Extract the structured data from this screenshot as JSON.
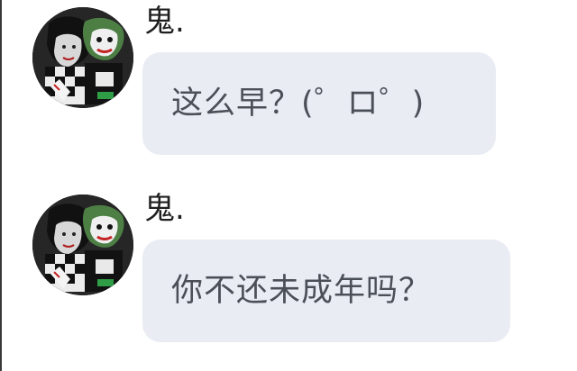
{
  "messages": [
    {
      "sender": "鬼.",
      "text": "这么早？(゜ロ゜)",
      "avatar_icon": "anime-avatar-joker-icon"
    },
    {
      "sender": "鬼.",
      "text": "你不还未成年吗？",
      "avatar_icon": "anime-avatar-joker-icon"
    }
  ],
  "colors": {
    "bubble_bg": "#e9ecf3",
    "text": "#4b4f57",
    "sender": "#1f1f1f"
  }
}
